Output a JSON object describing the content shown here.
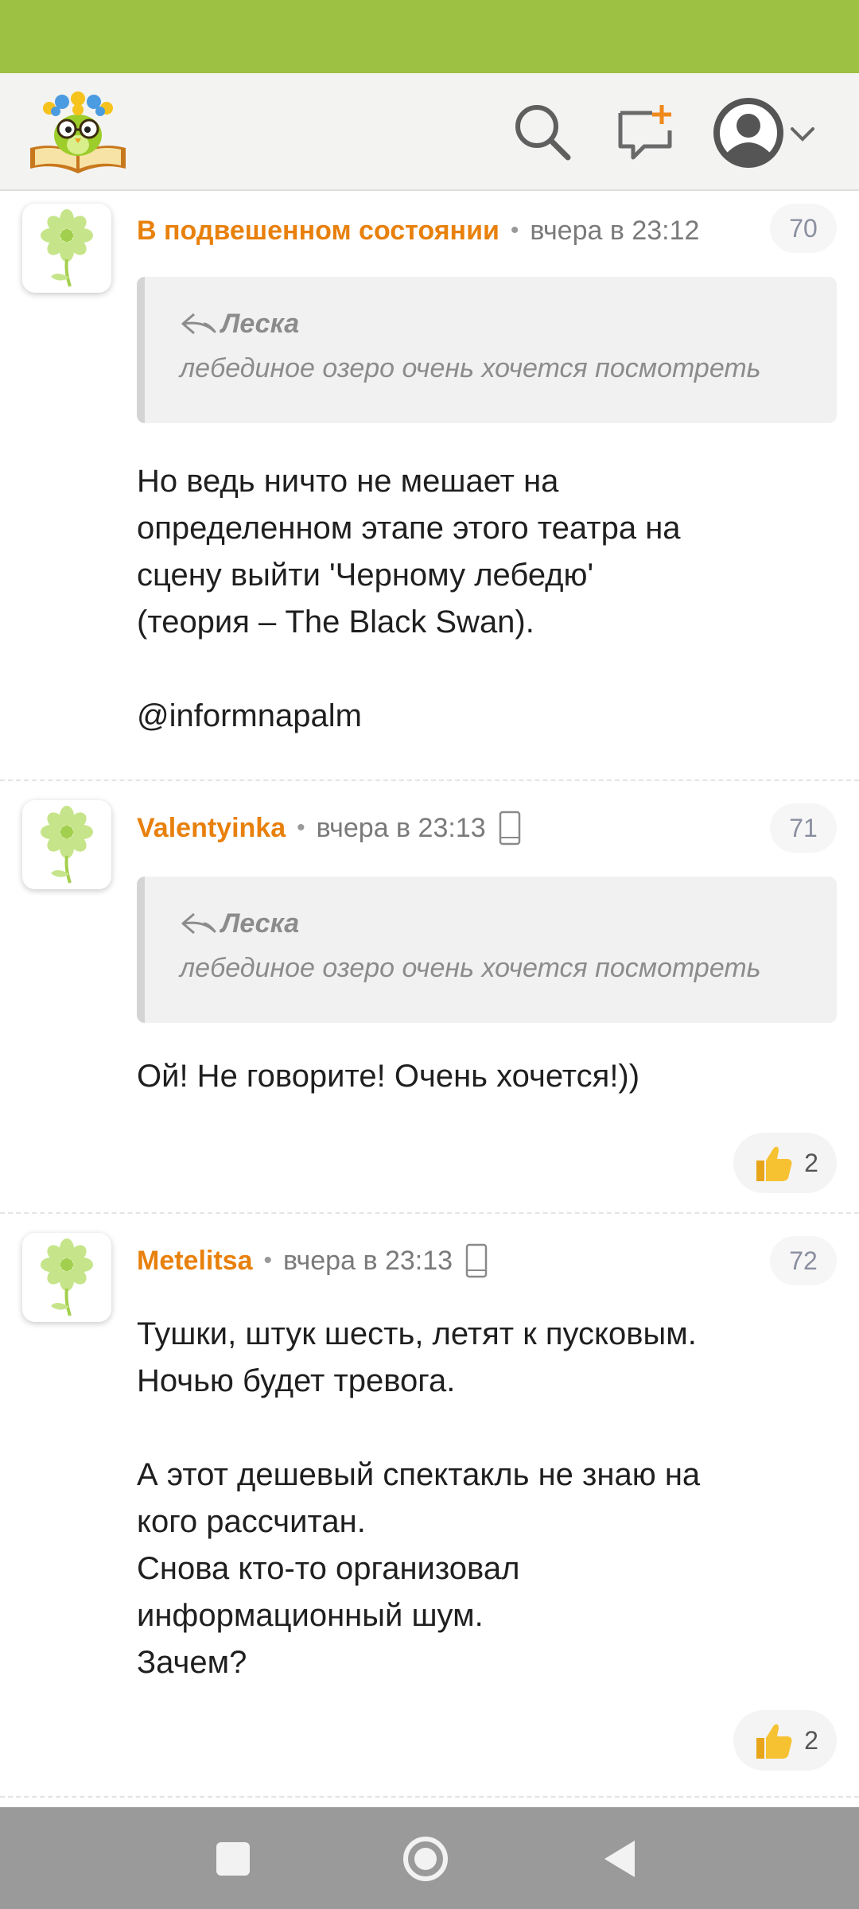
{
  "header": {
    "logo_icon": "owl-book-logo",
    "search_icon": "search-icon",
    "new_post_icon": "new-message-icon",
    "profile_icon": "user-avatar-icon"
  },
  "comments": [
    {
      "author": "В подвешенном состоянии",
      "time": "вчера в 23:12",
      "number": "70",
      "quote": {
        "author": "Леска",
        "text": "лебединое озеро очень хочется посмотреть"
      },
      "lines": [
        "Но ведь ничто не мешает на",
        "определенном этапе этого театра на",
        "сцену выйти 'Черному лебедю'",
        "(теория – The Black Swan).",
        "",
        "@informnapalm"
      ]
    },
    {
      "author": "Valentyinka",
      "time": "вчера в 23:13",
      "number": "71",
      "quote": {
        "author": "Леска",
        "text": "лебединое озеро очень хочется посмотреть"
      },
      "lines": [
        "Ой! Не говорите! Очень хочется!))"
      ],
      "likes": "2"
    },
    {
      "author": "Metelitsa",
      "time": "вчера в 23:13",
      "number": "72",
      "lines": [
        "Тушки, штук шесть, летят к пусковым.",
        "Ночью будет тревога.",
        "",
        "А этот дешевый спектакль не знаю на",
        "кого рассчитан.",
        "Снова кто-то организовал",
        "информационный шум.",
        "Зачем?"
      ],
      "likes": "2"
    }
  ],
  "colors": {
    "status_bar": "#9dc143",
    "author": "#e8800c",
    "nav_bar": "#9a9a9a"
  }
}
